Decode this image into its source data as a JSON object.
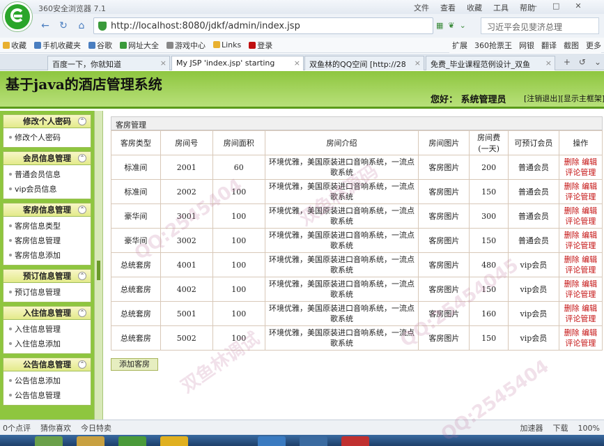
{
  "browser": {
    "app_title": "360安全浏览器 7.1",
    "menu": [
      "文件",
      "查看",
      "收藏",
      "工具",
      "帮助"
    ],
    "url": "http://localhost:8080/jdkf/admin/index.jsp",
    "search_placeholder": "习近平会见斐济总理",
    "favorites": [
      {
        "label": "收藏",
        "color": "#e8b030"
      },
      {
        "label": "手机收藏夹",
        "color": "#4a7ec0"
      },
      {
        "label": "谷歌",
        "color": "#4a7ec0"
      },
      {
        "label": "网址大全",
        "color": "#3a9a3a"
      },
      {
        "label": "游戏中心",
        "color": "#888888"
      },
      {
        "label": "Links",
        "color": "#e8b030"
      },
      {
        "label": "登录",
        "color": "#c01010"
      }
    ],
    "favorites_right": [
      "扩展",
      "360抢票王",
      "网银",
      "翻译",
      "截图",
      "更多"
    ],
    "tabs": [
      {
        "label": "百度一下，你就知道",
        "active": false
      },
      {
        "label": "My JSP 'index.jsp' starting",
        "active": true
      },
      {
        "label": "双鱼林的QQ空间 [http://28",
        "active": false
      },
      {
        "label": "免费_毕业课程范例设计_双鱼",
        "active": false
      }
    ],
    "status": {
      "left": [
        "0个点评",
        "猜你喜欢",
        "今日特卖"
      ],
      "right": [
        "加速器",
        "下载",
        "100%"
      ]
    }
  },
  "page": {
    "title": "基于java的酒店管理系统",
    "welcome": "您好：  系统管理员",
    "logout_link": "[注销退出]",
    "home_link": "[显示主框架]"
  },
  "sidebar": {
    "sections": [
      {
        "title": "修改个人密码",
        "items": [
          "修改个人密码"
        ]
      },
      {
        "title": "会员信息管理",
        "items": [
          "普通会员信息",
          "vip会员信息"
        ]
      },
      {
        "title": "客房信息管理",
        "items": [
          "客房信息类型",
          "客房信息管理",
          "客房信息添加"
        ]
      },
      {
        "title": "预订信息管理",
        "items": [
          "预订信息管理"
        ]
      },
      {
        "title": "入住信息管理",
        "items": [
          "入住信息管理",
          "入住信息添加"
        ]
      },
      {
        "title": "公告信息管理",
        "items": [
          "公告信息添加",
          "公告信息管理"
        ]
      }
    ]
  },
  "main": {
    "panel_title": "客房管理",
    "columns": [
      "客房类型",
      "房间号",
      "房间面积",
      "房间介绍",
      "房间图片",
      "房间费\n(一天)",
      "可预订会员",
      "操作"
    ],
    "ops": [
      "删除",
      "编辑",
      "评论管理"
    ],
    "rows": [
      [
        "标准间",
        "2001",
        "60",
        "环境优雅，美国原装进口音响系统，一流点歌系统",
        "客房图片",
        "200",
        "普通会员"
      ],
      [
        "标准间",
        "2002",
        "100",
        "环境优雅，美国原装进口音响系统，一流点歌系统",
        "客房图片",
        "150",
        "普通会员"
      ],
      [
        "豪华间",
        "3001",
        "100",
        "环境优雅，美国原装进口音响系统，一流点歌系统",
        "客房图片",
        "300",
        "普通会员"
      ],
      [
        "豪华间",
        "3002",
        "100",
        "环境优雅，美国原装进口音响系统，一流点歌系统",
        "客房图片",
        "150",
        "普通会员"
      ],
      [
        "总统套房",
        "4001",
        "100",
        "环境优雅，美国原装进口音响系统，一流点歌系统",
        "客房图片",
        "480",
        "vip会员"
      ],
      [
        "总统套房",
        "4002",
        "100",
        "环境优雅，美国原装进口音响系统，一流点歌系统",
        "客房图片",
        "150",
        "vip会员"
      ],
      [
        "总统套房",
        "5001",
        "100",
        "环境优雅，美国原装进口音响系统，一流点歌系统",
        "客房图片",
        "160",
        "vip会员"
      ],
      [
        "总统套房",
        "5002",
        "100",
        "环境优雅，美国原装进口音响系统，一流点歌系统",
        "客房图片",
        "150",
        "vip会员"
      ]
    ],
    "add_button": "添加客房"
  },
  "watermarks": [
    "QQ:2545404",
    "双鱼林源码",
    "QQ:25454045",
    "双鱼林调试",
    "QQ:2545404"
  ]
}
